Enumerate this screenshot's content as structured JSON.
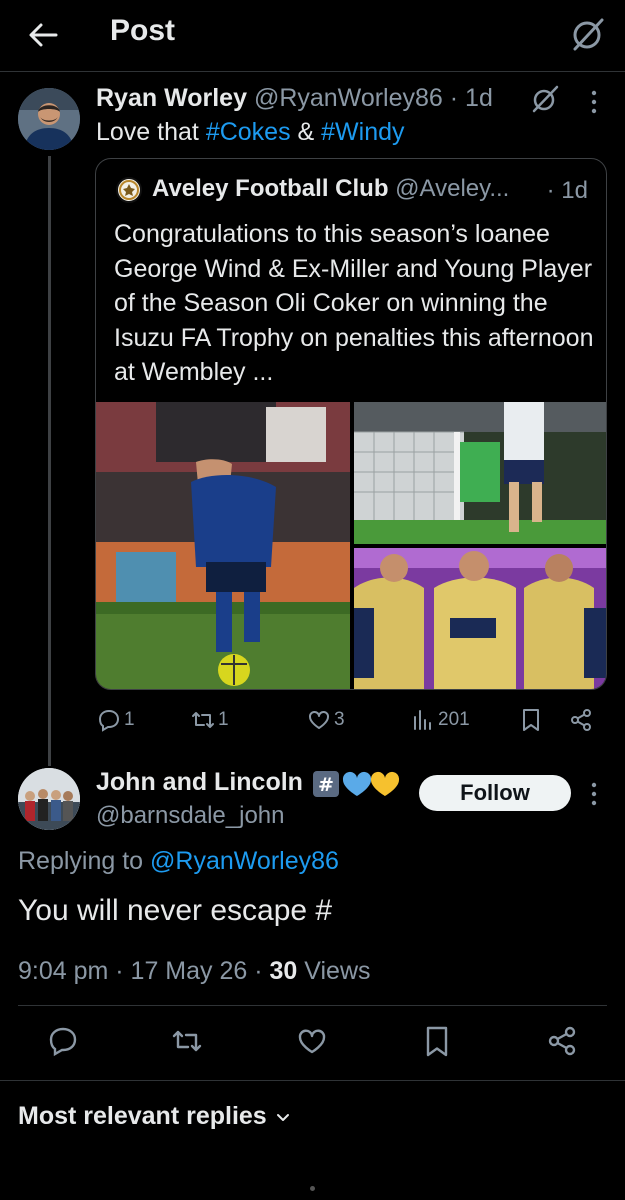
{
  "header": {
    "title": "Post"
  },
  "parent_post": {
    "author_name": "Ryan Worley",
    "author_handle": "@RyanWorley86",
    "time": "· 1d",
    "text_prefix": "Love that ",
    "hashtag1": "#Cokes",
    "text_mid": " & ",
    "hashtag2": "#Windy",
    "quote": {
      "author_name": "Aveley Football Club",
      "author_handle": "@Aveley...",
      "time": "· 1d",
      "text": "Congratulations to this season’s loanee George Wind & Ex-Miller and Young Player of the Season Oli Coker on winning the Isuzu FA Trophy on penalties this afternoon at Wembley ..."
    },
    "stats": {
      "replies": "1",
      "reposts": "1",
      "likes": "3",
      "views": "201"
    }
  },
  "reply": {
    "author_name": "John and Lincoln",
    "author_handle": "@barnsdale_john",
    "follow_label": "Follow",
    "replying_prefix": "Replying to ",
    "replying_handle": "@RyanWorley86",
    "text": "You will never escape #",
    "time_date": "9:04 pm · 17 May 26 · ",
    "views_count": "30",
    "views_label": " Views"
  },
  "replies_sort": {
    "label": "Most relevant replies"
  },
  "colors": {
    "accent": "#1d9bf0",
    "background": "#000000",
    "muted": "#8b98a5"
  }
}
